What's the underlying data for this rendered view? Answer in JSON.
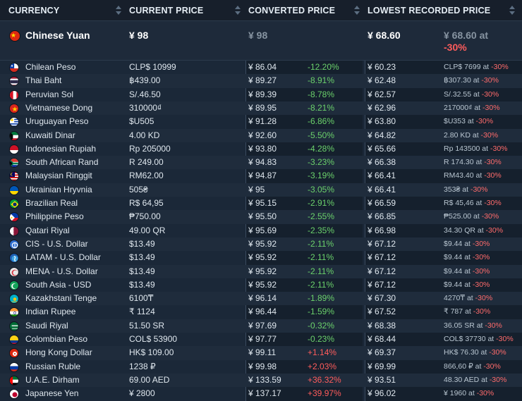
{
  "headers": {
    "currency": "CURRENCY",
    "current_price": "CURRENT PRICE",
    "converted_price": "CONVERTED PRICE",
    "lowest_recorded_price": "LOWEST RECORDED PRICE"
  },
  "featured": {
    "name": "Chinese Yuan",
    "current": "¥ 98",
    "converted": "¥ 98",
    "lowest": "¥ 68.60",
    "lowest_local_line1": "¥ 68.60 at",
    "lowest_local_line2": "-30%",
    "flag_icon": "china-flag-icon"
  },
  "rows": [
    {
      "name": "Chilean Peso",
      "current": "CLP$ 10999",
      "converted": "¥ 86.04",
      "change": "-12.20%",
      "lowest": "¥ 60.23",
      "lowest_local": "CLP$ 7699 at",
      "lowest_pct": "-30%",
      "flag": "chile"
    },
    {
      "name": "Thai Baht",
      "current": "฿439.00",
      "converted": "¥ 89.27",
      "change": "-8.91%",
      "lowest": "¥ 62.48",
      "lowest_local": "฿307.30 at",
      "lowest_pct": "-30%",
      "flag": "thailand"
    },
    {
      "name": "Peruvian Sol",
      "current": "S/.46.50",
      "converted": "¥ 89.39",
      "change": "-8.78%",
      "lowest": "¥ 62.57",
      "lowest_local": "S/.32.55 at",
      "lowest_pct": "-30%",
      "flag": "peru"
    },
    {
      "name": "Vietnamese Dong",
      "current": "310000₫",
      "converted": "¥ 89.95",
      "change": "-8.21%",
      "lowest": "¥ 62.96",
      "lowest_local": "217000₫ at",
      "lowest_pct": "-30%",
      "flag": "vietnam"
    },
    {
      "name": "Uruguayan Peso",
      "current": "$U505",
      "converted": "¥ 91.28",
      "change": "-6.86%",
      "lowest": "¥ 63.80",
      "lowest_local": "$U353 at",
      "lowest_pct": "-30%",
      "flag": "uruguay"
    },
    {
      "name": "Kuwaiti Dinar",
      "current": "4.00 KD",
      "converted": "¥ 92.60",
      "change": "-5.50%",
      "lowest": "¥ 64.82",
      "lowest_local": "2.80 KD at",
      "lowest_pct": "-30%",
      "flag": "kuwait"
    },
    {
      "name": "Indonesian Rupiah",
      "current": "Rp 205000",
      "converted": "¥ 93.80",
      "change": "-4.28%",
      "lowest": "¥ 65.66",
      "lowest_local": "Rp 143500 at",
      "lowest_pct": "-30%",
      "flag": "indonesia"
    },
    {
      "name": "South African Rand",
      "current": "R 249.00",
      "converted": "¥ 94.83",
      "change": "-3.23%",
      "lowest": "¥ 66.38",
      "lowest_local": "R 174.30 at",
      "lowest_pct": "-30%",
      "flag": "south-africa"
    },
    {
      "name": "Malaysian Ringgit",
      "current": "RM62.00",
      "converted": "¥ 94.87",
      "change": "-3.19%",
      "lowest": "¥ 66.41",
      "lowest_local": "RM43.40 at",
      "lowest_pct": "-30%",
      "flag": "malaysia"
    },
    {
      "name": "Ukrainian Hryvnia",
      "current": "505₴",
      "converted": "¥ 95",
      "change": "-3.05%",
      "lowest": "¥ 66.41",
      "lowest_local": "353₴ at",
      "lowest_pct": "-30%",
      "flag": "ukraine"
    },
    {
      "name": "Brazilian Real",
      "current": "R$ 64,95",
      "converted": "¥ 95.15",
      "change": "-2.91%",
      "lowest": "¥ 66.59",
      "lowest_local": "R$ 45,46 at",
      "lowest_pct": "-30%",
      "flag": "brazil"
    },
    {
      "name": "Philippine Peso",
      "current": "₱750.00",
      "converted": "¥ 95.50",
      "change": "-2.55%",
      "lowest": "¥ 66.85",
      "lowest_local": "₱525.00 at",
      "lowest_pct": "-30%",
      "flag": "philippines"
    },
    {
      "name": "Qatari Riyal",
      "current": "49.00 QR",
      "converted": "¥ 95.69",
      "change": "-2.35%",
      "lowest": "¥ 66.98",
      "lowest_local": "34.30 QR at",
      "lowest_pct": "-30%",
      "flag": "qatar"
    },
    {
      "name": "CIS - U.S. Dollar",
      "current": "$13.49",
      "converted": "¥ 95.92",
      "change": "-2.11%",
      "lowest": "¥ 67.12",
      "lowest_local": "$9.44 at",
      "lowest_pct": "-30%",
      "flag": "cis"
    },
    {
      "name": "LATAM - U.S. Dollar",
      "current": "$13.49",
      "converted": "¥ 95.92",
      "change": "-2.11%",
      "lowest": "¥ 67.12",
      "lowest_local": "$9.44 at",
      "lowest_pct": "-30%",
      "flag": "latam"
    },
    {
      "name": "MENA - U.S. Dollar",
      "current": "$13.49",
      "converted": "¥ 95.92",
      "change": "-2.11%",
      "lowest": "¥ 67.12",
      "lowest_local": "$9.44 at",
      "lowest_pct": "-30%",
      "flag": "mena"
    },
    {
      "name": "South Asia - USD",
      "current": "$13.49",
      "converted": "¥ 95.92",
      "change": "-2.11%",
      "lowest": "¥ 67.12",
      "lowest_local": "$9.44 at",
      "lowest_pct": "-30%",
      "flag": "south-asia"
    },
    {
      "name": "Kazakhstani Tenge",
      "current": "6100₸",
      "converted": "¥ 96.14",
      "change": "-1.89%",
      "lowest": "¥ 67.30",
      "lowest_local": "4270₸ at",
      "lowest_pct": "-30%",
      "flag": "kazakhstan"
    },
    {
      "name": "Indian Rupee",
      "current": "₹ 1124",
      "converted": "¥ 96.44",
      "change": "-1.59%",
      "lowest": "¥ 67.52",
      "lowest_local": "₹ 787 at",
      "lowest_pct": "-30%",
      "flag": "india"
    },
    {
      "name": "Saudi Riyal",
      "current": "51.50 SR",
      "converted": "¥ 97.69",
      "change": "-0.32%",
      "lowest": "¥ 68.38",
      "lowest_local": "36.05 SR at",
      "lowest_pct": "-30%",
      "flag": "saudi-arabia"
    },
    {
      "name": "Colombian Peso",
      "current": "COL$ 53900",
      "converted": "¥ 97.77",
      "change": "-0.23%",
      "lowest": "¥ 68.44",
      "lowest_local": "COL$ 37730 at",
      "lowest_pct": "-30%",
      "flag": "colombia"
    },
    {
      "name": "Hong Kong Dollar",
      "current": "HK$ 109.00",
      "converted": "¥ 99.11",
      "change": "+1.14%",
      "lowest": "¥ 69.37",
      "lowest_local": "HK$ 76.30 at",
      "lowest_pct": "-30%",
      "flag": "hong-kong"
    },
    {
      "name": "Russian Ruble",
      "current": "1238 ₽",
      "converted": "¥ 99.98",
      "change": "+2.03%",
      "lowest": "¥ 69.99",
      "lowest_local": "866,60 ₽ at",
      "lowest_pct": "-30%",
      "flag": "russia"
    },
    {
      "name": "U.A.E. Dirham",
      "current": "69.00 AED",
      "converted": "¥ 133.59",
      "change": "+36.32%",
      "lowest": "¥ 93.51",
      "lowest_local": "48.30 AED at",
      "lowest_pct": "-30%",
      "flag": "uae"
    },
    {
      "name": "Japanese Yen",
      "current": "¥ 2800",
      "converted": "¥ 137.17",
      "change": "+39.97%",
      "lowest": "¥ 96.02",
      "lowest_local": "¥ 1960 at",
      "lowest_pct": "-30%",
      "flag": "japan"
    }
  ],
  "colors": {
    "background": "#1b2838",
    "header_bg": "#171f2b",
    "increase": "#ff5c5c",
    "decrease": "#6bd16b"
  }
}
